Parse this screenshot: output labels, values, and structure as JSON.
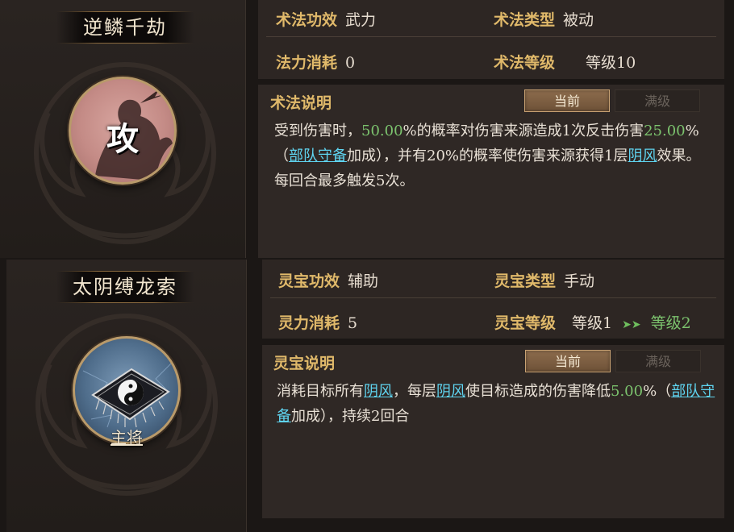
{
  "skill": {
    "name": "逆鳞千劫",
    "emblem_glyph": "攻",
    "stats": {
      "power_label": "术法功效",
      "power_value": "武力",
      "type_label": "术法类型",
      "type_value": "被动",
      "cost_label": "法力消耗",
      "cost_value": "0",
      "level_label": "术法等级",
      "level_value": "等级10"
    },
    "desc": {
      "title": "术法说明",
      "tab_current": "当前",
      "tab_max": "满级",
      "t1": "受到伤害时，",
      "t2": "50.00",
      "t3": "%的概率对伤害来源造成1次反击伤害",
      "t4": "25.00",
      "t5": "%（",
      "t6": "部队守备",
      "t7": "加成），并有20%的概率使伤害来源获得1层",
      "t8": "阴风",
      "t9": "效果。每回合最多触发5次。"
    }
  },
  "lingbao": {
    "name": "太阴缚龙索",
    "role_label": "主将",
    "stats": {
      "power_label": "灵宝功效",
      "power_value": "辅助",
      "type_label": "灵宝类型",
      "type_value": "手动",
      "cost_label": "灵力消耗",
      "cost_value": "5",
      "level_label": "灵宝等级",
      "level_value": "等级1",
      "level_arrow": "➤➤",
      "level_next": "等级2"
    },
    "desc": {
      "title": "灵宝说明",
      "tab_current": "当前",
      "tab_max": "满级",
      "t1": "消耗目标所有",
      "t2": "阴风",
      "t3": "，每层",
      "t4": "阴风",
      "t5": "使目标造成的伤害降低",
      "t6": "5.00",
      "t7": "%（",
      "t8": "部队守备",
      "t9": "加成），持续2回合"
    }
  },
  "colors": {
    "gold_label": "#e0b96a",
    "green_value": "#7cc36e",
    "cyan_keyword": "#5fd4f0"
  },
  "icons": [
    "ornament-swirl-icon",
    "attack-silhouette-icon",
    "yin-yang-flag-icon",
    "double-arrow-icon"
  ]
}
